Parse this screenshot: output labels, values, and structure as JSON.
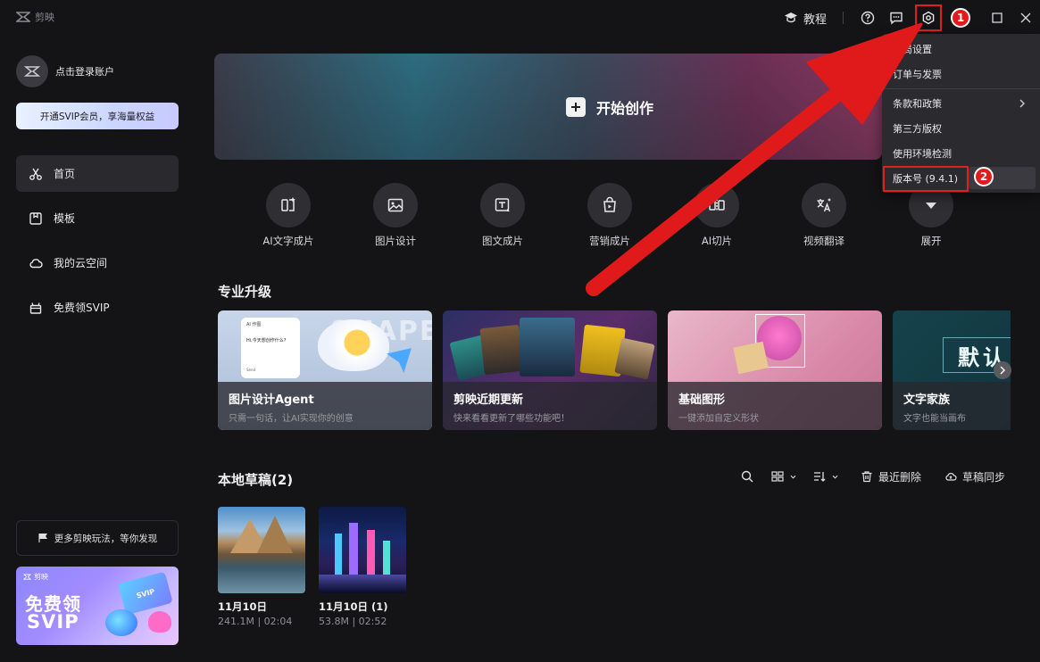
{
  "app": {
    "name": "剪映"
  },
  "titlebar": {
    "tutorial": "教程"
  },
  "annotations": {
    "badge_1": "1",
    "badge_2": "2"
  },
  "sidebar": {
    "login": "点击登录账户",
    "svip_cta": "开通SVIP会员，享海量权益",
    "nav": [
      {
        "label": "首页",
        "icon": "scissors-icon",
        "active": true
      },
      {
        "label": "模板",
        "icon": "template-icon",
        "active": false
      },
      {
        "label": "我的云空间",
        "icon": "cloud-icon",
        "active": false
      },
      {
        "label": "免费领SVIP",
        "icon": "gift-icon",
        "active": false
      }
    ],
    "more_fun": "更多剪映玩法，等你发现",
    "promo": {
      "brand": "剪映",
      "line1": "免费领",
      "line2": "SVIP",
      "card": "SVIP"
    }
  },
  "hero": {
    "label": "开始创作"
  },
  "tools": [
    {
      "label": "AI文字成片",
      "icon": "ai-text-icon"
    },
    {
      "label": "图片设计",
      "icon": "image-icon"
    },
    {
      "label": "图文成片",
      "icon": "text-image-icon"
    },
    {
      "label": "营销成片",
      "icon": "shopping-bag-icon"
    },
    {
      "label": "AI切片",
      "icon": "ai-cut-icon"
    },
    {
      "label": "视频翻译",
      "icon": "translate-icon"
    },
    {
      "label": "展开",
      "icon": "chevron-down-icon"
    }
  ],
  "pro": {
    "title": "专业升级",
    "cards": [
      {
        "title": "图片设计Agent",
        "sub": "只需一句话，让AI实现你的创意"
      },
      {
        "title": "剪映近期更新",
        "sub": "快来看看更新了哪些功能吧！"
      },
      {
        "title": "基础图形",
        "sub": "一键添加自定义形状"
      },
      {
        "title": "文字家族",
        "sub": "文字也能当画布"
      }
    ],
    "card_art": {
      "agent_mini": "AI 作图",
      "agent_q": "Hi,今天想创作什么?",
      "agent_btn": "Send",
      "texture": "SHAPE",
      "banner": "默认"
    }
  },
  "drafts": {
    "title": "本地草稿(2)",
    "recent_delete": "最近删除",
    "sync": "草稿同步",
    "items": [
      {
        "name": "11月10日",
        "meta": "241.1M | 02:04"
      },
      {
        "name": "11月10日 (1)",
        "meta": "53.8M | 02:52"
      }
    ]
  },
  "menu": {
    "items": [
      "全局设置",
      "订单与发票",
      "条款和政策",
      "第三方版权",
      "使用环境检测",
      "版本号 (9.4.1)"
    ]
  },
  "colors": {
    "annotation_red": "#e21a1a",
    "background": "#141416"
  }
}
